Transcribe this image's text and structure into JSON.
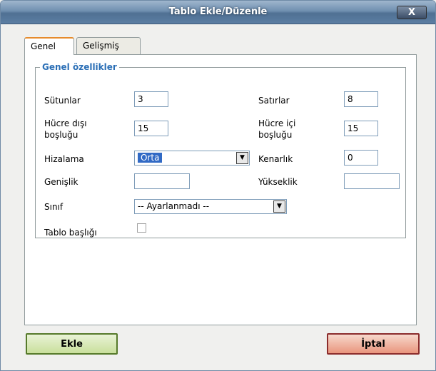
{
  "window": {
    "title": "Tablo Ekle/Düzenle",
    "close_label": "X"
  },
  "tabs": [
    {
      "label": "Genel",
      "active": true
    },
    {
      "label": "Gelişmiş",
      "active": false
    }
  ],
  "group": {
    "legend": "Genel özellikler"
  },
  "fields": {
    "columns": {
      "label": "Sütunlar",
      "value": "3"
    },
    "rows": {
      "label": "Satırlar",
      "value": "8"
    },
    "cellspacing": {
      "label1": "Hücre dışı",
      "label2": "boşluğu",
      "value": "15"
    },
    "cellpadding": {
      "label1": "Hücre içi",
      "label2": "boşluğu",
      "value": "15"
    },
    "align": {
      "label": "Hizalama",
      "value": "Orta"
    },
    "border": {
      "label": "Kenarlık",
      "value": "0"
    },
    "width": {
      "label": "Genişlik",
      "value": ""
    },
    "height": {
      "label": "Yükseklik",
      "value": ""
    },
    "class": {
      "label": "Sınıf",
      "value": "-- Ayarlanmadı --"
    },
    "caption": {
      "label": "Tablo başlığı",
      "checked": false
    }
  },
  "buttons": {
    "insert": "Ekle",
    "cancel": "İptal"
  },
  "colors": {
    "accent": "#2b6fb6",
    "insert_border": "#567a2a",
    "cancel_border": "#8b2c2c"
  }
}
